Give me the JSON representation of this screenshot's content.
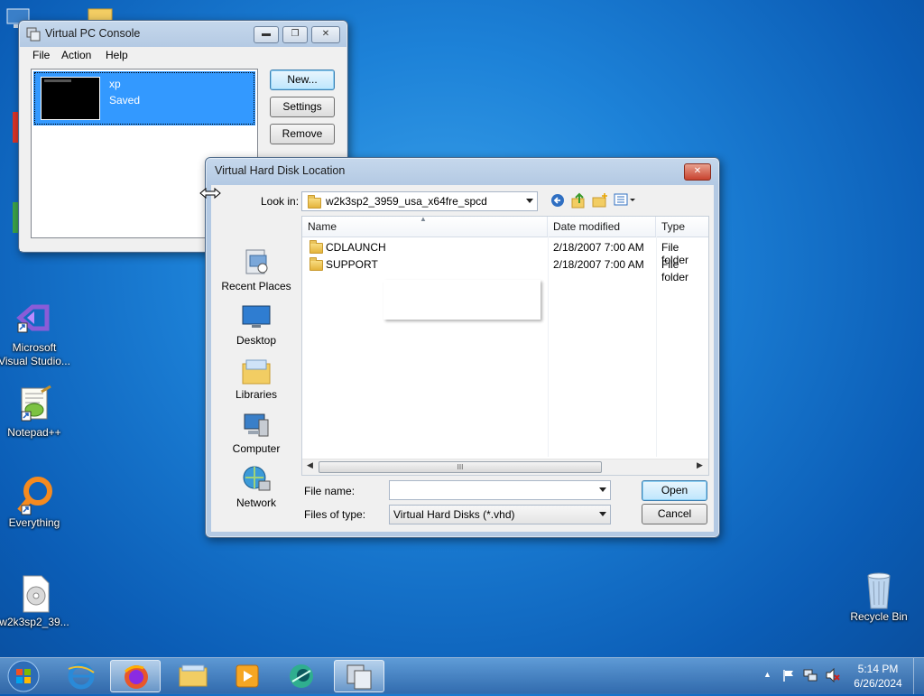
{
  "desktop": {
    "icons": [
      {
        "label": "Microsoft Visual Studio..."
      },
      {
        "label": "Notepad++"
      },
      {
        "label": "Everything"
      },
      {
        "label": "w2k3sp2_39..."
      },
      {
        "label": "Recycle Bin"
      }
    ]
  },
  "vpc": {
    "title": "Virtual PC Console",
    "menu": [
      "File",
      "Action",
      "Help"
    ],
    "vm": {
      "name": "xp",
      "status": "Saved"
    },
    "buttons": {
      "new": "New...",
      "settings": "Settings",
      "remove": "Remove"
    }
  },
  "dialog": {
    "title": "Virtual Hard Disk Location",
    "look_in_label": "Look in:",
    "look_in_value": "w2k3sp2_3959_usa_x64fre_spcd",
    "places": [
      "Recent Places",
      "Desktop",
      "Libraries",
      "Computer",
      "Network"
    ],
    "columns": {
      "name": "Name",
      "date": "Date modified",
      "type": "Type"
    },
    "files": [
      {
        "name": "CDLAUNCH",
        "date": "2/18/2007 7:00 AM",
        "type": "File folder"
      },
      {
        "name": "SUPPORT",
        "date": "2/18/2007 7:00 AM",
        "type": "File folder"
      }
    ],
    "file_name_label": "File name:",
    "file_name_value": "",
    "files_of_type_label": "Files of type:",
    "files_of_type_value": "Virtual Hard Disks (*.vhd)",
    "open_label": "Open",
    "cancel_label": "Cancel",
    "hscroll_grip": "III"
  },
  "taskbar": {
    "clock_time": "5:14 PM",
    "clock_date": "6/26/2024"
  },
  "colors": {
    "selection": "#3399ff",
    "close_red": "#c8432f"
  }
}
